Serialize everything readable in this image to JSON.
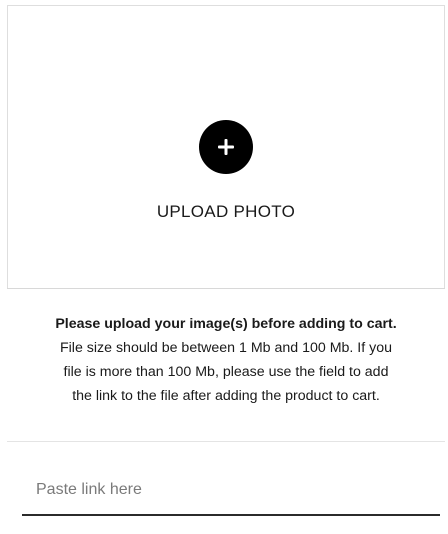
{
  "upload": {
    "icon": "plus-icon",
    "label": "UPLOAD PHOTO"
  },
  "instructions": {
    "heading": "Please upload your image(s) before adding to cart.",
    "line1": "File size should be between 1 Mb and 100 Mb. If you",
    "line2": "file is more than 100 Mb, please use the field to add",
    "line3": "the link to the file after adding the product to cart."
  },
  "link_field": {
    "placeholder": "Paste link here",
    "value": ""
  },
  "colors": {
    "icon_background": "#000000",
    "icon_foreground": "#ffffff",
    "border": "#dedede"
  }
}
